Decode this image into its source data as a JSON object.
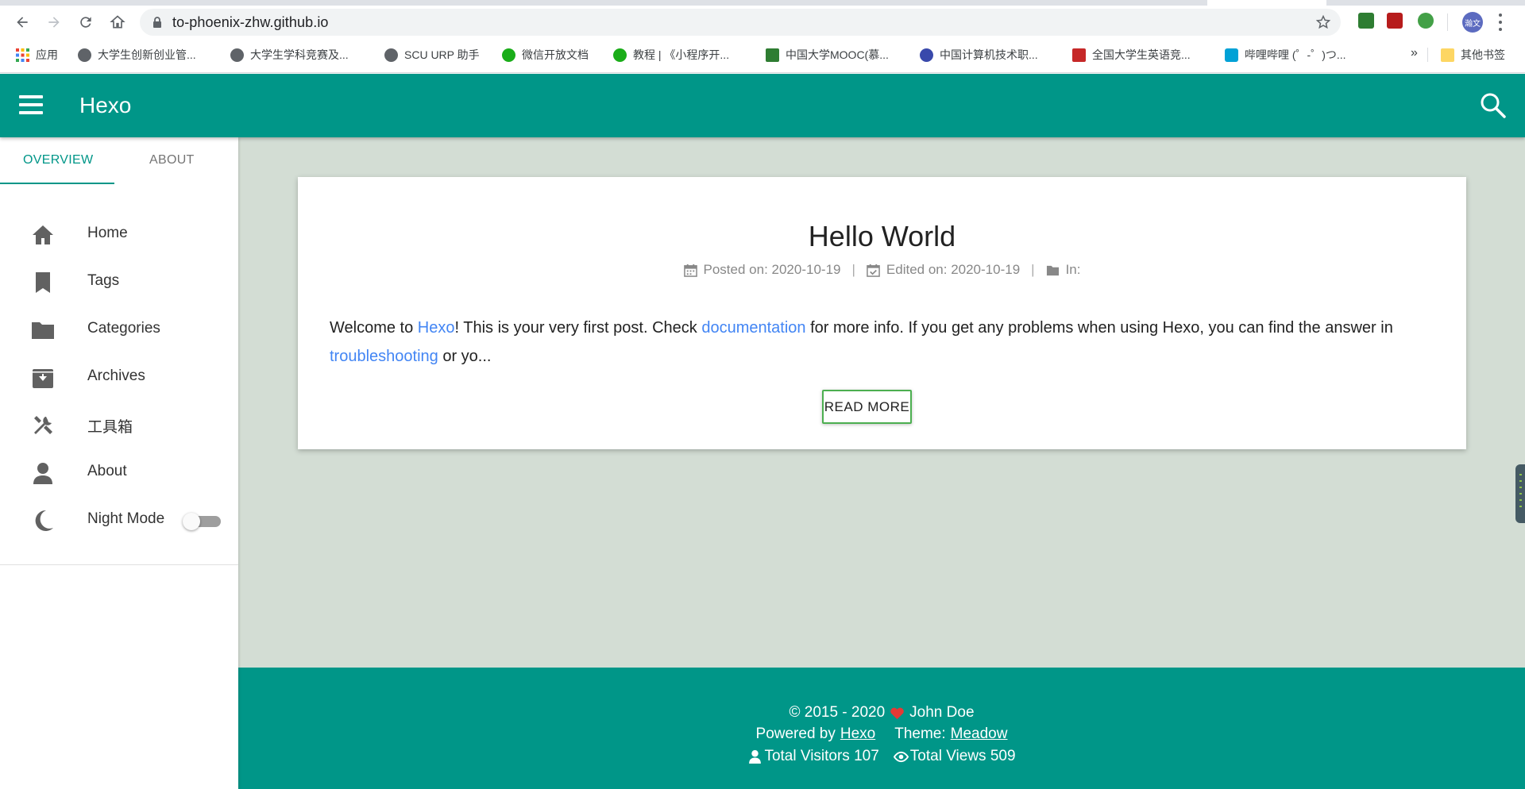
{
  "browser": {
    "url": "to-phoenix-zhw.github.io",
    "avatar_text": "瀚文",
    "bookmarks": [
      {
        "label": "应用",
        "color": "#ea4335"
      },
      {
        "label": "大学生创新创业管...",
        "color": "#5f6368"
      },
      {
        "label": "大学生学科竞赛及...",
        "color": "#5f6368"
      },
      {
        "label": "SCU URP 助手",
        "color": "#5f6368"
      },
      {
        "label": "微信开放文档",
        "color": "#1aad19"
      },
      {
        "label": "教程 | 《小程序开...",
        "color": "#1aad19"
      },
      {
        "label": "中国大学MOOC(慕...",
        "color": "#2e7d32"
      },
      {
        "label": "中国计算机技术职...",
        "color": "#3949ab"
      },
      {
        "label": "全国大学生英语竞...",
        "color": "#c62828"
      },
      {
        "label": "哔哩哔哩 (゜-゜)つ...",
        "color": "#00a1d6"
      }
    ],
    "more": "»",
    "other_bookmarks": "其他书签"
  },
  "header": {
    "title": "Hexo",
    "color": "#009688"
  },
  "sidebar": {
    "tabs": [
      "OVERVIEW",
      "ABOUT"
    ],
    "items": [
      {
        "label": "Home",
        "icon": "home-icon"
      },
      {
        "label": "Tags",
        "icon": "bookmark-icon"
      },
      {
        "label": "Categories",
        "icon": "folder-icon"
      },
      {
        "label": "Archives",
        "icon": "archive-icon"
      },
      {
        "label": "工具箱",
        "icon": "tools-icon"
      },
      {
        "label": "About",
        "icon": "user-icon"
      },
      {
        "label": "Night Mode",
        "icon": "moon-icon",
        "toggle": false
      }
    ]
  },
  "post": {
    "title": "Hello World",
    "posted_label": "Posted on: 2020-10-19",
    "edited_label": "Edited on: 2020-10-19",
    "category_label": "In:",
    "separator": "|",
    "excerpt": {
      "t1": "Welcome to ",
      "link1": "Hexo",
      "t2": "! This is your very first post. Check ",
      "link2": "documentation",
      "t3": " for more info. If you get any problems when using Hexo, you can find the answer in ",
      "link3": "troubleshooting",
      "t4": " or yo..."
    },
    "read_more": "READ MORE"
  },
  "footer": {
    "copyright": "© 2015 - 2020",
    "author": "John Doe",
    "powered_by": "Powered by",
    "powered_link": "Hexo",
    "theme_label": "Theme:",
    "theme_link": "Meadow",
    "visitors": "Total Visitors 107",
    "views": "Total Views 509",
    "heart_color": "#e53935"
  },
  "colors": {
    "accent": "#009688",
    "main_bg": "#d3ddd4",
    "link": "#4285f4",
    "button_border": "#4caf50"
  }
}
